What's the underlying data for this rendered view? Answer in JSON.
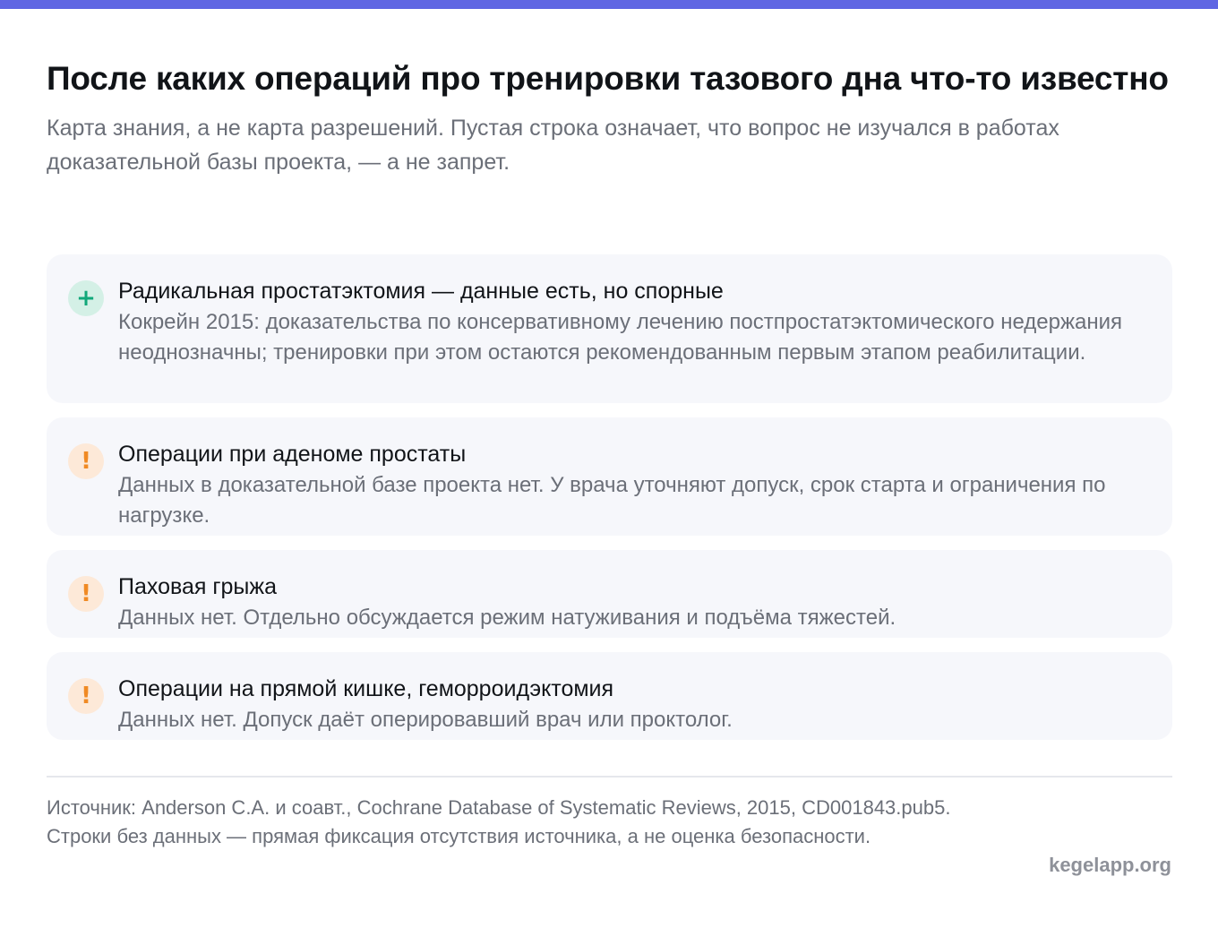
{
  "header": {
    "title": "После каких операций про тренировки тазового дна что-то известно",
    "subtitle": "Карта знания, а не карта разрешений. Пустая строка означает, что вопрос не изучался в работах доказательной базы проекта, — а не запрет."
  },
  "cards": [
    {
      "icon": "plus-icon",
      "badge": "+",
      "title": "Радикальная простатэктомия — данные есть, но спорные",
      "text": "Кокрейн 2015: доказательства по консервативному лечению постпростатэктомического недержания неоднозначны; тренировки при этом остаются рекомендованным первым этапом реабилитации."
    },
    {
      "icon": "exclamation-icon",
      "badge": "!",
      "title": "Операции при аденоме простаты",
      "text": "Данных в доказательной базе проекта нет. У врача уточняют допуск, срок старта и ограничения по нагрузке."
    },
    {
      "icon": "exclamation-icon",
      "badge": "!",
      "title": "Паховая грыжа",
      "text": "Данных нет. Отдельно обсуждается режим натуживания и подъёма тяжестей."
    },
    {
      "icon": "exclamation-icon",
      "badge": "!",
      "title": "Операции на прямой кишке, геморроидэктомия",
      "text": "Данных нет. Допуск даёт оперировавший врач или проктолог."
    }
  ],
  "footer": {
    "source": "Источник: Anderson C.A. и соавт., Cochrane Database of Systematic Reviews, 2015, CD001843.pub5. Строки без данных — прямая фиксация отсутствия источника, а не оценка безопасности.",
    "site": "kegelapp.org"
  },
  "colors": {
    "accent_bar": "#5f66e3",
    "positive": "#11a87a",
    "warning": "#f08a24",
    "card_background": "#f6f7fb"
  }
}
